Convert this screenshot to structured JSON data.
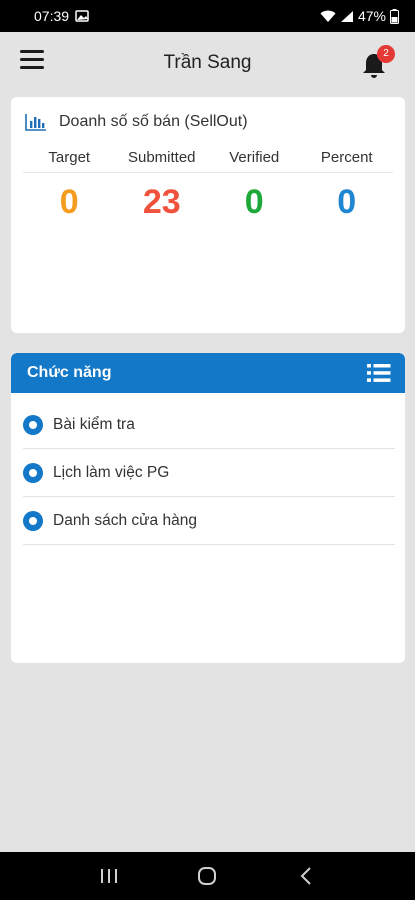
{
  "status_bar": {
    "time": "07:39",
    "battery": "47%"
  },
  "header": {
    "title": "Trần Sang",
    "notification_count": "2"
  },
  "sales_card": {
    "title": "Doanh số số bán (SellOut)",
    "metrics": [
      {
        "label": "Target",
        "value": "0",
        "color": "#f39c1f"
      },
      {
        "label": "Submitted",
        "value": "23",
        "color": "#f0533d"
      },
      {
        "label": "Verified",
        "value": "0",
        "color": "#1fa83a"
      },
      {
        "label": "Percent",
        "value": "0",
        "color": "#1f86d1"
      }
    ]
  },
  "functions_card": {
    "title": "Chức năng",
    "items": [
      {
        "label": "Bài kiểm tra"
      },
      {
        "label": "Lịch làm việc PG"
      },
      {
        "label": "Danh sách cửa hàng"
      }
    ]
  },
  "colors": {
    "accent": "#1378c7",
    "background": "#e3e3e3"
  },
  "icons": {
    "menu": "hamburger-icon",
    "notifications": "bell-icon",
    "chart": "bar-chart-icon",
    "list": "list-icon",
    "nav_recent": "recent-apps-icon",
    "nav_home": "home-icon",
    "nav_back": "back-icon"
  }
}
